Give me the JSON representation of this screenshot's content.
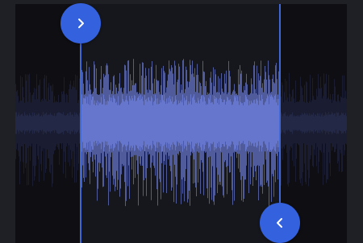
{
  "trimmer": {
    "selection_start": 0.197,
    "selection_end": 0.798
  },
  "colors": {
    "background": "#1f2025",
    "track": "#16171c",
    "wave_selected": "#6677cc",
    "wave_unselected": "#3d4578",
    "handle": "#3461dd"
  },
  "icons": {
    "start_handle": "chevron-right-icon",
    "end_handle": "chevron-left-icon"
  }
}
